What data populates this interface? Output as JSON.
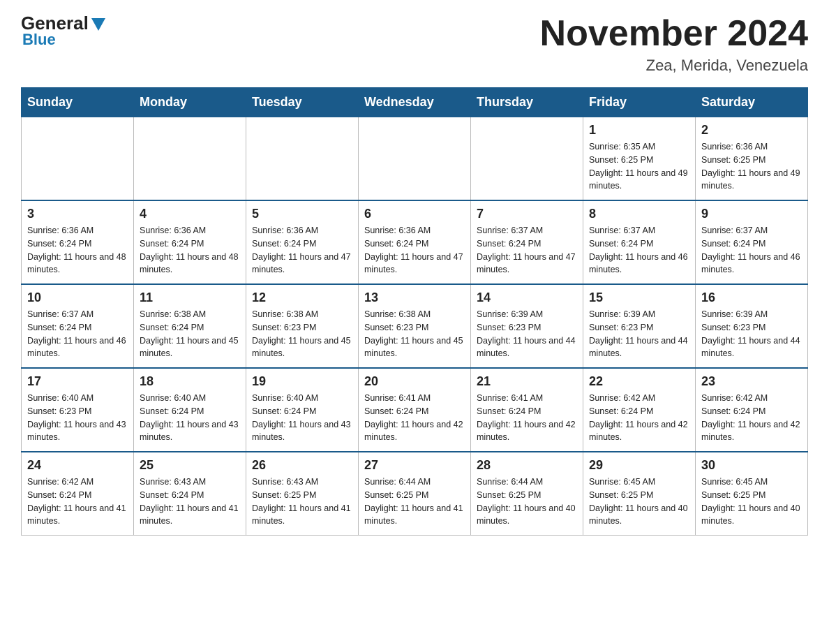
{
  "header": {
    "logo_general": "General",
    "logo_blue": "Blue",
    "month_title": "November 2024",
    "location": "Zea, Merida, Venezuela"
  },
  "days_of_week": [
    "Sunday",
    "Monday",
    "Tuesday",
    "Wednesday",
    "Thursday",
    "Friday",
    "Saturday"
  ],
  "weeks": [
    [
      {
        "day": "",
        "info": ""
      },
      {
        "day": "",
        "info": ""
      },
      {
        "day": "",
        "info": ""
      },
      {
        "day": "",
        "info": ""
      },
      {
        "day": "",
        "info": ""
      },
      {
        "day": "1",
        "info": "Sunrise: 6:35 AM\nSunset: 6:25 PM\nDaylight: 11 hours and 49 minutes."
      },
      {
        "day": "2",
        "info": "Sunrise: 6:36 AM\nSunset: 6:25 PM\nDaylight: 11 hours and 49 minutes."
      }
    ],
    [
      {
        "day": "3",
        "info": "Sunrise: 6:36 AM\nSunset: 6:24 PM\nDaylight: 11 hours and 48 minutes."
      },
      {
        "day": "4",
        "info": "Sunrise: 6:36 AM\nSunset: 6:24 PM\nDaylight: 11 hours and 48 minutes."
      },
      {
        "day": "5",
        "info": "Sunrise: 6:36 AM\nSunset: 6:24 PM\nDaylight: 11 hours and 47 minutes."
      },
      {
        "day": "6",
        "info": "Sunrise: 6:36 AM\nSunset: 6:24 PM\nDaylight: 11 hours and 47 minutes."
      },
      {
        "day": "7",
        "info": "Sunrise: 6:37 AM\nSunset: 6:24 PM\nDaylight: 11 hours and 47 minutes."
      },
      {
        "day": "8",
        "info": "Sunrise: 6:37 AM\nSunset: 6:24 PM\nDaylight: 11 hours and 46 minutes."
      },
      {
        "day": "9",
        "info": "Sunrise: 6:37 AM\nSunset: 6:24 PM\nDaylight: 11 hours and 46 minutes."
      }
    ],
    [
      {
        "day": "10",
        "info": "Sunrise: 6:37 AM\nSunset: 6:24 PM\nDaylight: 11 hours and 46 minutes."
      },
      {
        "day": "11",
        "info": "Sunrise: 6:38 AM\nSunset: 6:24 PM\nDaylight: 11 hours and 45 minutes."
      },
      {
        "day": "12",
        "info": "Sunrise: 6:38 AM\nSunset: 6:23 PM\nDaylight: 11 hours and 45 minutes."
      },
      {
        "day": "13",
        "info": "Sunrise: 6:38 AM\nSunset: 6:23 PM\nDaylight: 11 hours and 45 minutes."
      },
      {
        "day": "14",
        "info": "Sunrise: 6:39 AM\nSunset: 6:23 PM\nDaylight: 11 hours and 44 minutes."
      },
      {
        "day": "15",
        "info": "Sunrise: 6:39 AM\nSunset: 6:23 PM\nDaylight: 11 hours and 44 minutes."
      },
      {
        "day": "16",
        "info": "Sunrise: 6:39 AM\nSunset: 6:23 PM\nDaylight: 11 hours and 44 minutes."
      }
    ],
    [
      {
        "day": "17",
        "info": "Sunrise: 6:40 AM\nSunset: 6:23 PM\nDaylight: 11 hours and 43 minutes."
      },
      {
        "day": "18",
        "info": "Sunrise: 6:40 AM\nSunset: 6:24 PM\nDaylight: 11 hours and 43 minutes."
      },
      {
        "day": "19",
        "info": "Sunrise: 6:40 AM\nSunset: 6:24 PM\nDaylight: 11 hours and 43 minutes."
      },
      {
        "day": "20",
        "info": "Sunrise: 6:41 AM\nSunset: 6:24 PM\nDaylight: 11 hours and 42 minutes."
      },
      {
        "day": "21",
        "info": "Sunrise: 6:41 AM\nSunset: 6:24 PM\nDaylight: 11 hours and 42 minutes."
      },
      {
        "day": "22",
        "info": "Sunrise: 6:42 AM\nSunset: 6:24 PM\nDaylight: 11 hours and 42 minutes."
      },
      {
        "day": "23",
        "info": "Sunrise: 6:42 AM\nSunset: 6:24 PM\nDaylight: 11 hours and 42 minutes."
      }
    ],
    [
      {
        "day": "24",
        "info": "Sunrise: 6:42 AM\nSunset: 6:24 PM\nDaylight: 11 hours and 41 minutes."
      },
      {
        "day": "25",
        "info": "Sunrise: 6:43 AM\nSunset: 6:24 PM\nDaylight: 11 hours and 41 minutes."
      },
      {
        "day": "26",
        "info": "Sunrise: 6:43 AM\nSunset: 6:25 PM\nDaylight: 11 hours and 41 minutes."
      },
      {
        "day": "27",
        "info": "Sunrise: 6:44 AM\nSunset: 6:25 PM\nDaylight: 11 hours and 41 minutes."
      },
      {
        "day": "28",
        "info": "Sunrise: 6:44 AM\nSunset: 6:25 PM\nDaylight: 11 hours and 40 minutes."
      },
      {
        "day": "29",
        "info": "Sunrise: 6:45 AM\nSunset: 6:25 PM\nDaylight: 11 hours and 40 minutes."
      },
      {
        "day": "30",
        "info": "Sunrise: 6:45 AM\nSunset: 6:25 PM\nDaylight: 11 hours and 40 minutes."
      }
    ]
  ]
}
